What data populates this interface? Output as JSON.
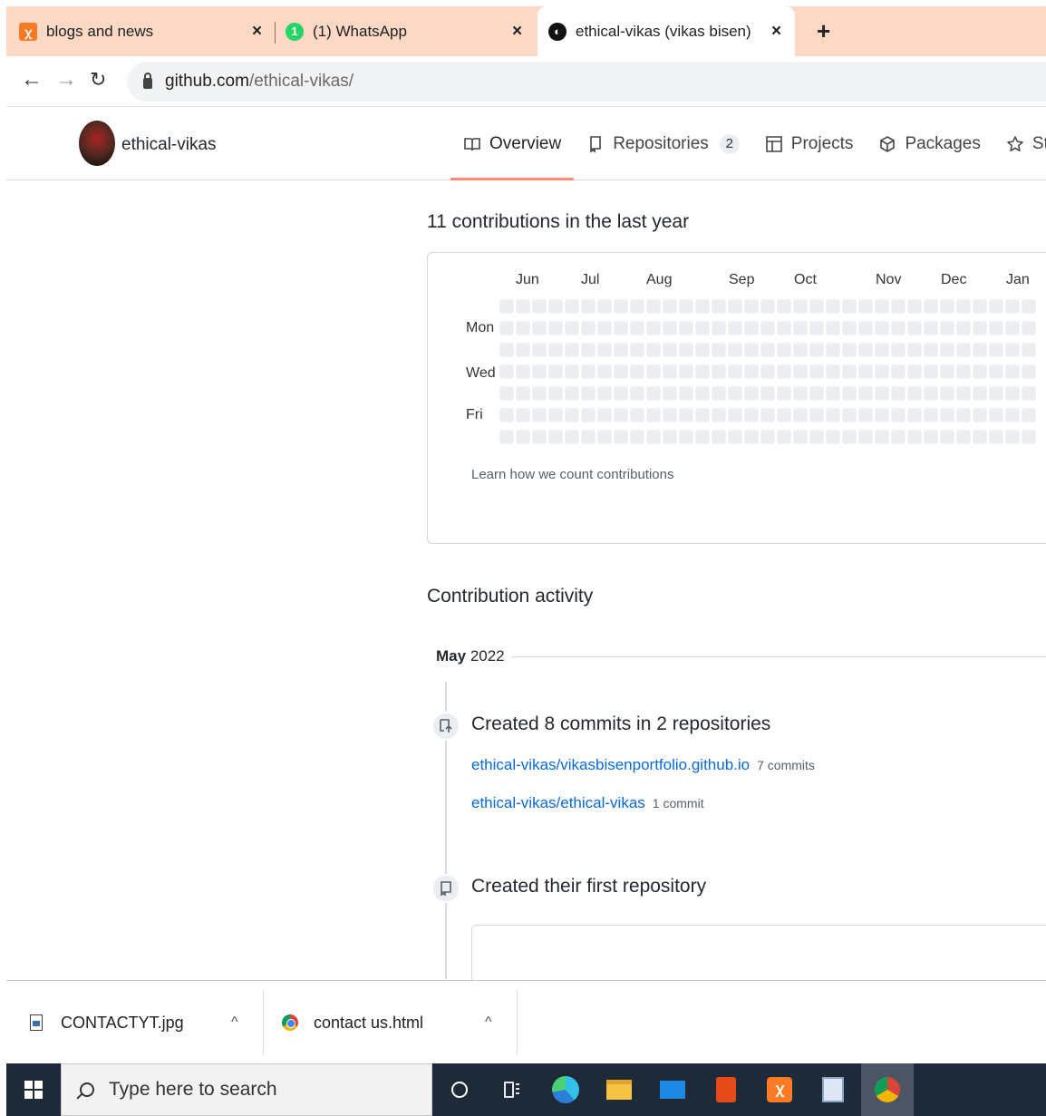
{
  "browser": {
    "tabs": [
      {
        "title": "blogs and news",
        "icon": "xampp-icon",
        "color": "#fb7a24"
      },
      {
        "title": "(1) WhatsApp",
        "icon": "whatsapp-icon",
        "color": "#25d366"
      },
      {
        "title": "ethical-vikas (vikas bisen)",
        "icon": "github-icon",
        "color": "#000000"
      }
    ],
    "url_host": "github.com",
    "url_path": "/ethical-vikas/"
  },
  "profile": {
    "username": "ethical-vikas",
    "nav": [
      {
        "label": "Overview",
        "icon": "book-icon"
      },
      {
        "label": "Repositories",
        "icon": "repo-icon",
        "count": "2"
      },
      {
        "label": "Projects",
        "icon": "table-icon"
      },
      {
        "label": "Packages",
        "icon": "package-icon"
      },
      {
        "label": "Stars",
        "icon": "star-icon"
      }
    ]
  },
  "contributions": {
    "title": "11 contributions in the last year",
    "months": [
      "Jun",
      "Jul",
      "Aug",
      "Sep",
      "Oct",
      "Nov",
      "Dec",
      "Jan"
    ],
    "days": [
      "Mon",
      "Wed",
      "Fri"
    ],
    "learn_link": "Learn how we count contributions",
    "empty_color": "#ebedf0"
  },
  "activity": {
    "title": "Contribution activity",
    "month": "May",
    "year": "2022",
    "events": [
      {
        "title": "Created 8 commits in 2 repositories",
        "icon": "repo-push-icon",
        "repos": [
          {
            "name": "ethical-vikas/vikasbisenportfolio.github.io",
            "count": "7 commits"
          },
          {
            "name": "ethical-vikas/ethical-vikas",
            "count": "1 commit"
          }
        ]
      },
      {
        "title": "Created their first repository",
        "icon": "repo-icon"
      }
    ]
  },
  "downloads": [
    {
      "name": "CONTACTYT.jpg",
      "icon": "image-file-icon"
    },
    {
      "name": "contact us.html",
      "icon": "chrome-icon"
    }
  ],
  "taskbar": {
    "search_placeholder": "Type here to search"
  }
}
